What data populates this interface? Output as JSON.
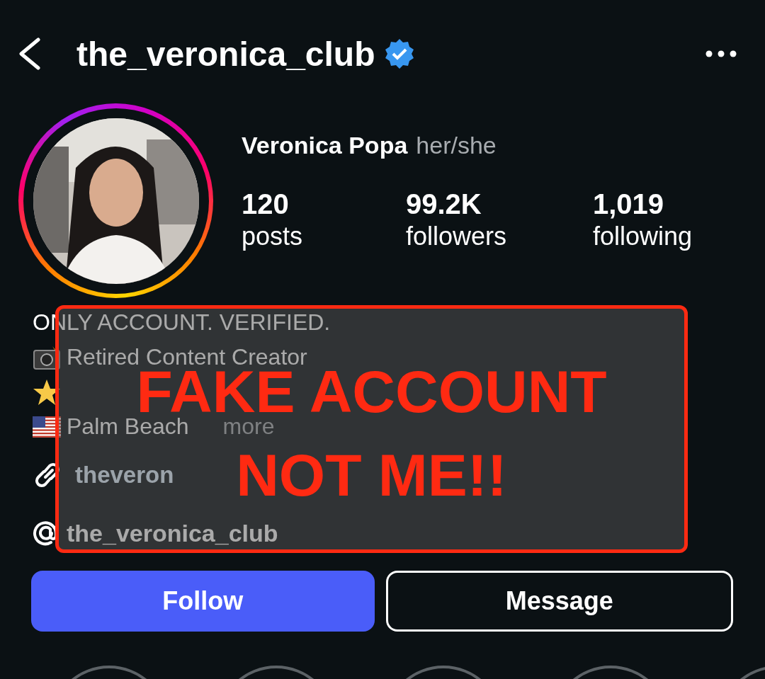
{
  "header": {
    "username": "the_veronica_club",
    "verified": true
  },
  "profile": {
    "name": "Veronica Popa",
    "pronouns": "her/she",
    "has_story": true,
    "stats": [
      {
        "value": "120",
        "label": "posts"
      },
      {
        "value": "99.2K",
        "label": "followers"
      },
      {
        "value": "1,019",
        "label": "following"
      }
    ]
  },
  "bio": {
    "lines": [
      {
        "kind": "plain",
        "text": "ONLY ACCOUNT. VERIFIED."
      },
      {
        "kind": "camera",
        "text": "Retired Content Creator"
      },
      {
        "kind": "star"
      },
      {
        "kind": "flag",
        "text": "Palm Beach",
        "more": "more"
      }
    ],
    "link": "theveron",
    "threads": "the_veronica_club"
  },
  "overlay": {
    "lines": [
      "FAKE ACCOUNT",
      "NOT ME!!"
    ]
  },
  "buttons": [
    {
      "kind": "primary",
      "label": "Follow"
    },
    {
      "kind": "secondary",
      "label": "Message"
    }
  ]
}
